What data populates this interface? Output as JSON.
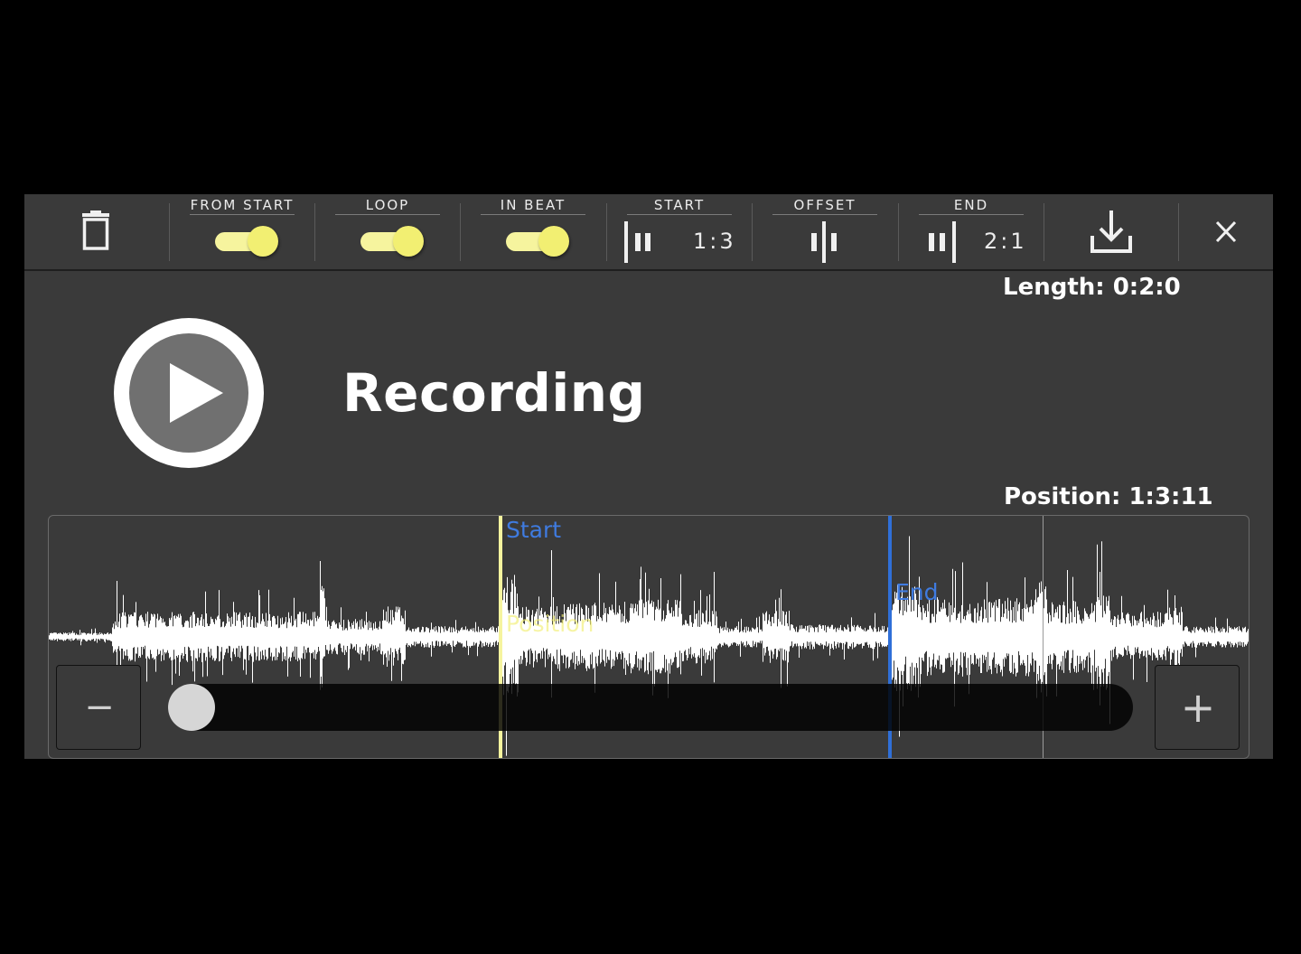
{
  "toolbar": {
    "from_start": {
      "label": "FROM START",
      "on": true
    },
    "loop": {
      "label": "LOOP",
      "on": true
    },
    "in_beat": {
      "label": "IN BEAT",
      "on": true
    },
    "start": {
      "label": "START",
      "value": "1:3"
    },
    "offset": {
      "label": "OFFSET"
    },
    "end": {
      "label": "END",
      "value": "2:1"
    },
    "icons": {
      "delete": "trash-icon",
      "download": "download-icon",
      "close": "close-icon"
    }
  },
  "info": {
    "length": "Length: 0:2:0",
    "position": "Position: 1:3:11"
  },
  "recording": {
    "title": "Recording",
    "play_icon": "play-icon"
  },
  "waveform": {
    "start_label": "Start",
    "end_label": "End",
    "position_label": "Position",
    "zoom_out": "−",
    "zoom_in": "+",
    "scroll_position": 0
  },
  "colors": {
    "background": "#000000",
    "panel": "#3a3a3a",
    "toggle_on": "#f2ef72",
    "start_marker": "#f6f49e",
    "end_marker": "#2f6fd8",
    "marker_text": "#3f7be0",
    "waveform": "#ffffff"
  }
}
